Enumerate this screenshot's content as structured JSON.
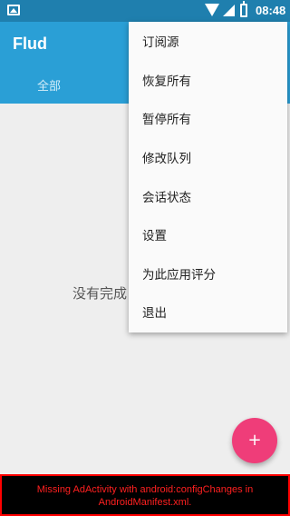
{
  "status_bar": {
    "time": "08:48",
    "icons": [
      "notification-image-icon",
      "wifi-icon",
      "signal-icon",
      "battery-charging-icon"
    ]
  },
  "app_bar": {
    "title": "Flud",
    "tabs": [
      {
        "label": "全部"
      }
    ],
    "color": "#2a9fd6"
  },
  "main": {
    "empty_text": "没有完成"
  },
  "menu": {
    "items": [
      {
        "label": "订阅源"
      },
      {
        "label": "恢复所有"
      },
      {
        "label": "暂停所有"
      },
      {
        "label": "修改队列"
      },
      {
        "label": "会话状态"
      },
      {
        "label": "设置"
      },
      {
        "label": "为此应用评分"
      },
      {
        "label": "退出"
      }
    ]
  },
  "fab": {
    "label": "+",
    "icon": "add-icon",
    "color": "#ef3d79"
  },
  "ad_error": {
    "line1": "Missing AdActivity with android:configChanges in",
    "line2": "AndroidManifest.xml.",
    "color": "#ff0000"
  }
}
